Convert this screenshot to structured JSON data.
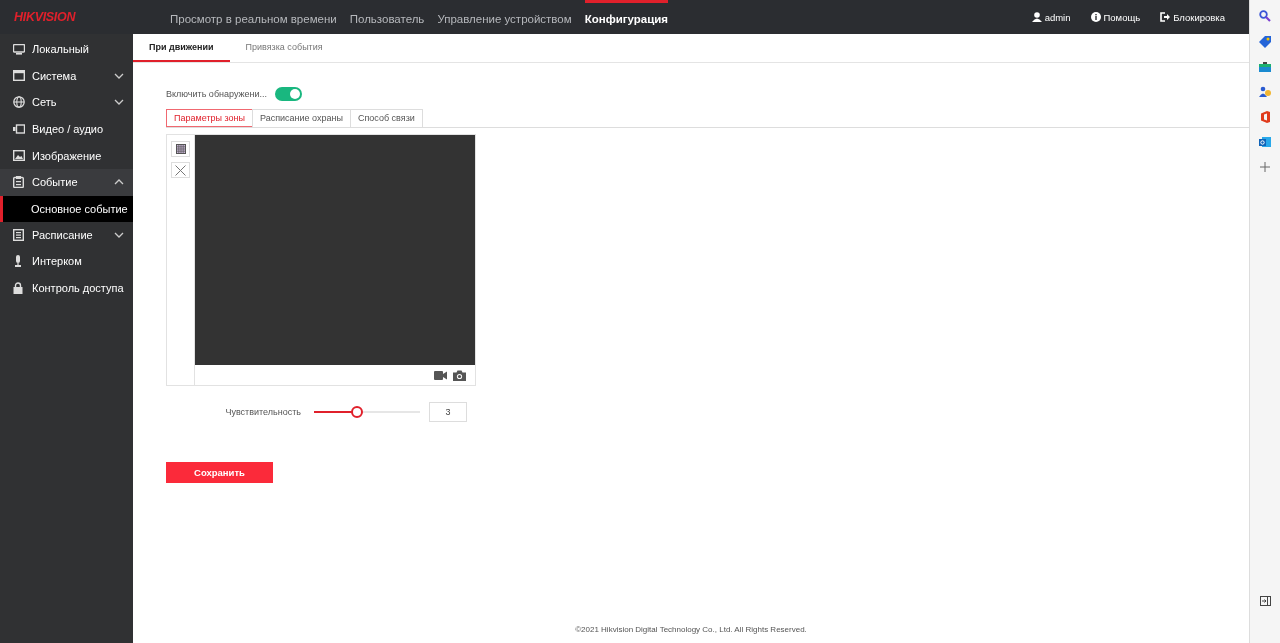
{
  "header": {
    "logo": "HIKVISION",
    "nav": [
      {
        "label": "Просмотр в реальном времени",
        "selected": false
      },
      {
        "label": "Пользователь",
        "selected": false
      },
      {
        "label": "Управление устройством",
        "selected": false
      },
      {
        "label": "Конфигурация",
        "selected": true
      }
    ],
    "user": "admin",
    "help": "Помощь",
    "lock": "Блокировка"
  },
  "sidebar": {
    "items": [
      {
        "label": "Локальный"
      },
      {
        "label": "Система",
        "expanded": false
      },
      {
        "label": "Сеть",
        "expanded": false
      },
      {
        "label": "Видео / аудио"
      },
      {
        "label": "Изображение"
      },
      {
        "label": "Событие",
        "expanded": true,
        "children": [
          {
            "label": "Основное событие",
            "selected": true
          }
        ]
      },
      {
        "label": "Расписание",
        "expanded": false
      },
      {
        "label": "Интерком"
      },
      {
        "label": "Контроль доступа"
      }
    ]
  },
  "tabs": [
    {
      "label": "При движении",
      "selected": true
    },
    {
      "label": "Привязка события",
      "selected": false
    }
  ],
  "enable_detection": {
    "label": "Включить обнаружени...",
    "on": true
  },
  "subtabs": [
    {
      "label": "Параметры зоны",
      "selected": true
    },
    {
      "label": "Расписание охраны",
      "selected": false
    },
    {
      "label": "Способ связи",
      "selected": false
    }
  ],
  "sensitivity": {
    "label": "Чувствительность",
    "level": 0.41,
    "reading": "3"
  },
  "save_button": "Сохранить",
  "footer": "©2021 Hikvision Digital Technology Co., Ltd. All Rights Reserved."
}
